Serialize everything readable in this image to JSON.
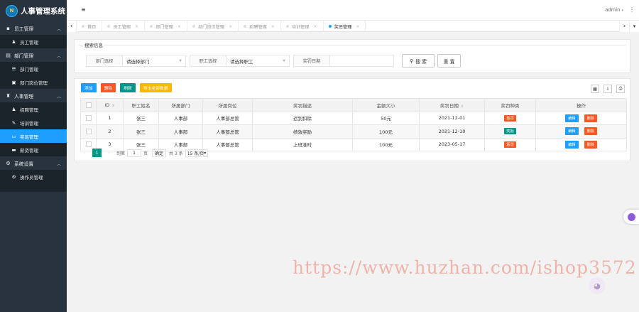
{
  "app": {
    "title": "人事管理系统",
    "logo_text": "N"
  },
  "sidebar": {
    "groups": [
      {
        "label": "员工管理",
        "items": [
          {
            "label": "员工管理"
          }
        ]
      },
      {
        "label": "部门管理",
        "items": [
          {
            "label": "部门管理"
          },
          {
            "label": "部门岗位管理"
          }
        ]
      },
      {
        "label": "人事管理",
        "items": [
          {
            "label": "招聘管理"
          },
          {
            "label": "培训管理"
          },
          {
            "label": "奖惩管理"
          },
          {
            "label": "薪资管理"
          }
        ]
      },
      {
        "label": "系统设置",
        "items": [
          {
            "label": "操作员管理"
          }
        ]
      }
    ],
    "active_item": "奖惩管理"
  },
  "topbar": {
    "menu_icon": "≡",
    "user": "admin",
    "caret": "▾",
    "settings_icon": "⋮"
  },
  "tabs": {
    "items": [
      {
        "label": "首页",
        "closable": false
      },
      {
        "label": "员工管理",
        "closable": true
      },
      {
        "label": "部门管理",
        "closable": true
      },
      {
        "label": "部门岗位管理",
        "closable": true
      },
      {
        "label": "招聘管理",
        "closable": true
      },
      {
        "label": "培训管理",
        "closable": true
      },
      {
        "label": "奖惩管理",
        "closable": true,
        "active": true
      }
    ],
    "close_glyph": "×",
    "nav_left": "‹",
    "nav_right": "›",
    "nav_more": "▾"
  },
  "search": {
    "legend": "搜索信息",
    "dept_label": "部门选择",
    "dept_value": "请选择部门",
    "emp_label": "职工选择",
    "emp_value": "请选择职工",
    "date_label": "奖罚日期",
    "date_value": "",
    "search_button": "搜 索",
    "reset_button": "重 置"
  },
  "toolbar": {
    "add": "添加",
    "delete": "删除",
    "refresh": "刷新",
    "export": "导出全部数据"
  },
  "table": {
    "headers": [
      "ID",
      "职工姓名",
      "所属部门",
      "所属岗位",
      "奖罚描述",
      "金额大小",
      "奖罚日期",
      "奖罚种类",
      "操作"
    ],
    "rows": [
      {
        "id": "1",
        "name": "张三",
        "dept": "人事部",
        "post": "人事部总管",
        "desc": "迟到扣除",
        "amount": "50元",
        "date": "2021-12-01",
        "kind": "惩罚",
        "kind_color": "#ff5722"
      },
      {
        "id": "2",
        "name": "张三",
        "dept": "人事部",
        "post": "人事部总管",
        "desc": "绩效奖励",
        "amount": "100元",
        "date": "2021-12-10",
        "kind": "奖励",
        "kind_color": "#009688"
      },
      {
        "id": "3",
        "name": "张三",
        "dept": "人事部",
        "post": "人事部总管",
        "desc": "上班准时",
        "amount": "100元",
        "date": "2023-05-17",
        "kind": "惩罚",
        "kind_color": "#ff5722"
      }
    ],
    "edit_label": "编辑",
    "delete_label": "删除"
  },
  "pager": {
    "current": "1",
    "goto_label": "到第",
    "page_input": "1",
    "page_unit": "页",
    "confirm": "确定",
    "total": "共 3 条",
    "size": "15 条/页"
  },
  "watermark": "https://www.huzhan.com/ishop3572",
  "colors": {
    "sidebar_bg": "#28333e",
    "active": "#1e9fff",
    "danger": "#ff5722",
    "teal": "#009688",
    "warm": "#ffb800"
  }
}
